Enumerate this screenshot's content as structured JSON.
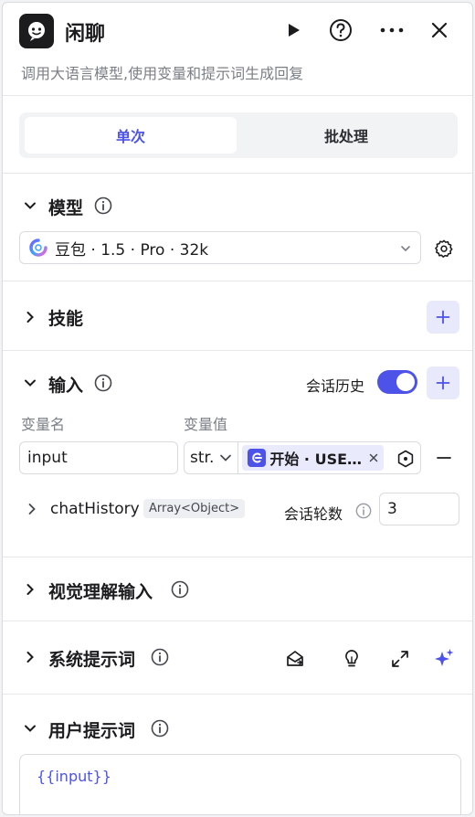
{
  "header": {
    "title": "闲聊",
    "description": "调用大语言模型,使用变量和提示词生成回复",
    "logo_icon": "chat-bot-logo",
    "actions": [
      "play-icon",
      "help-icon",
      "more-icon",
      "close-icon"
    ]
  },
  "tabs": [
    {
      "label": "单次",
      "active": true
    },
    {
      "label": "批处理",
      "active": false
    }
  ],
  "model": {
    "section_title": "模型",
    "selected": "豆包 · 1.5 · Pro · 32k"
  },
  "skills": {
    "section_title": "技能"
  },
  "inputs": {
    "section_title": "输入",
    "history_label": "会话历史",
    "history_enabled": true,
    "col_name": "变量名",
    "col_value": "变量值",
    "var_name": "input",
    "var_type": "str.",
    "ref_label": "开始 · USE…",
    "chat_history_name": "chatHistory",
    "chat_history_type": "Array<Object>",
    "rounds_label": "会话轮数",
    "rounds_value": "3"
  },
  "vision": {
    "section_title": "视觉理解输入"
  },
  "system_prompt": {
    "section_title": "系统提示词"
  },
  "user_prompt": {
    "section_title": "用户提示词",
    "content": "{{input}}"
  },
  "colors": {
    "accent": "#4d53e8",
    "accent_light": "#e8eafb",
    "text_secondary": "#7b7f87",
    "border": "#d9dbe0"
  }
}
